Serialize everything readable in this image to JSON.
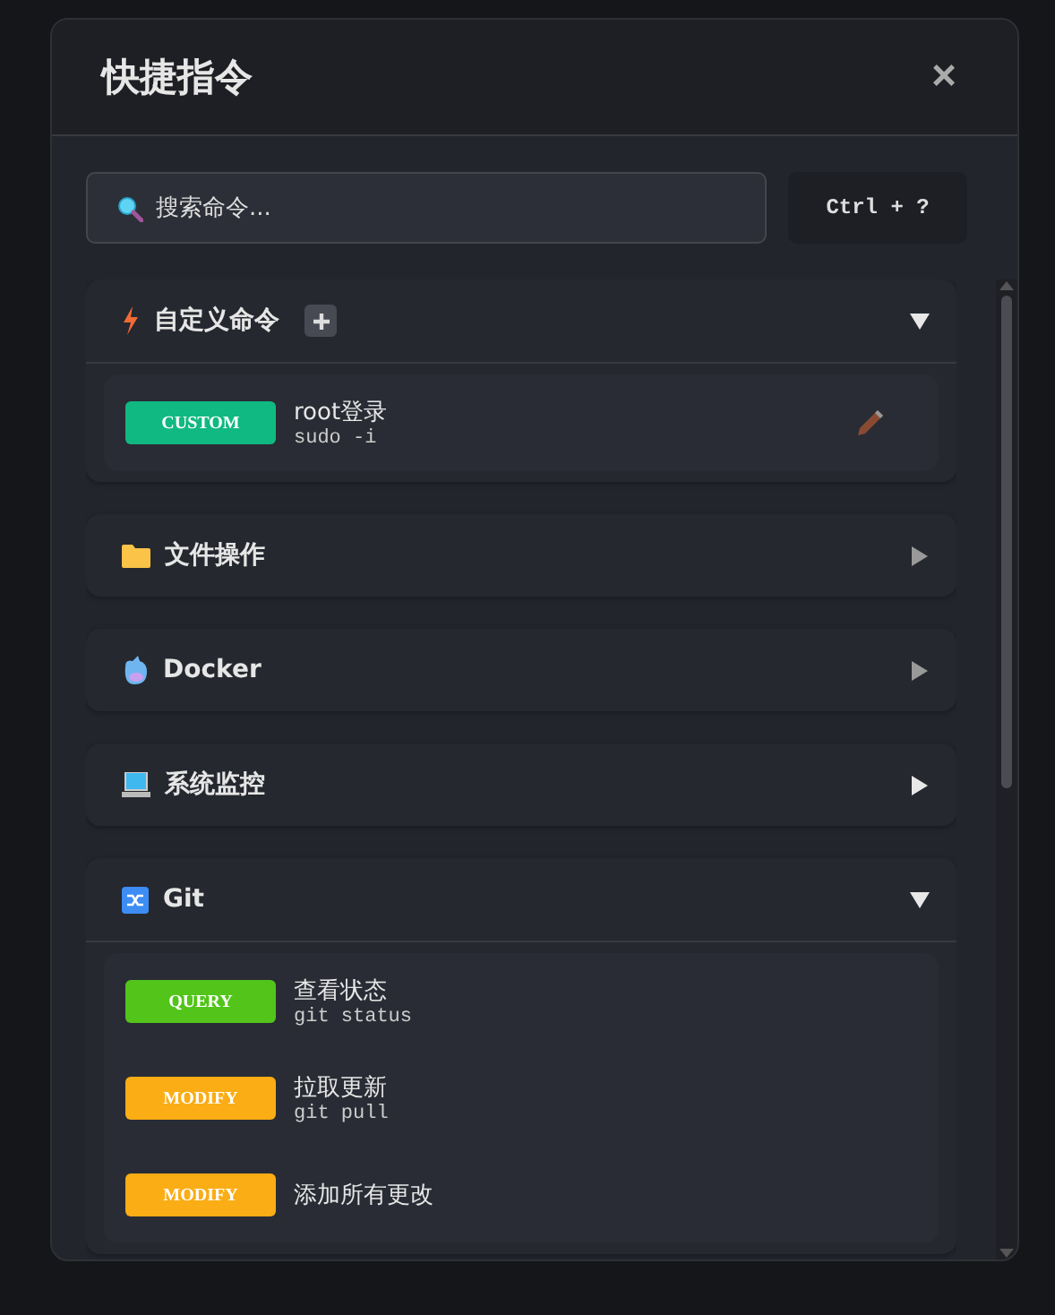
{
  "dialog": {
    "title": "快捷指令",
    "close": "×"
  },
  "search": {
    "placeholder": "搜索命令..."
  },
  "shortcut": "Ctrl + ?",
  "sections": [
    {
      "title": "自定义命令",
      "addable": true,
      "expanded": true,
      "commands": [
        {
          "badge": "CUSTOM",
          "color": "#10b981",
          "name": "root登录",
          "command": "sudo -i",
          "editable": true
        }
      ]
    },
    {
      "title": "文件操作",
      "addable": false,
      "expanded": false
    },
    {
      "title": "Docker",
      "addable": false,
      "expanded": false
    },
    {
      "title": "系统监控",
      "addable": false,
      "expanded": false
    },
    {
      "title": "Git",
      "addable": false,
      "expanded": true,
      "commands": [
        {
          "badge": "QUERY",
          "color": "#52c41a",
          "name": "查看状态",
          "command": "git status",
          "editable": false
        },
        {
          "badge": "MODIFY",
          "color": "#faad14",
          "name": "拉取更新",
          "command": "git pull",
          "editable": false
        },
        {
          "badge": "MODIFY",
          "color": "#faad14",
          "name": "添加所有更改",
          "editable": false
        }
      ]
    }
  ]
}
